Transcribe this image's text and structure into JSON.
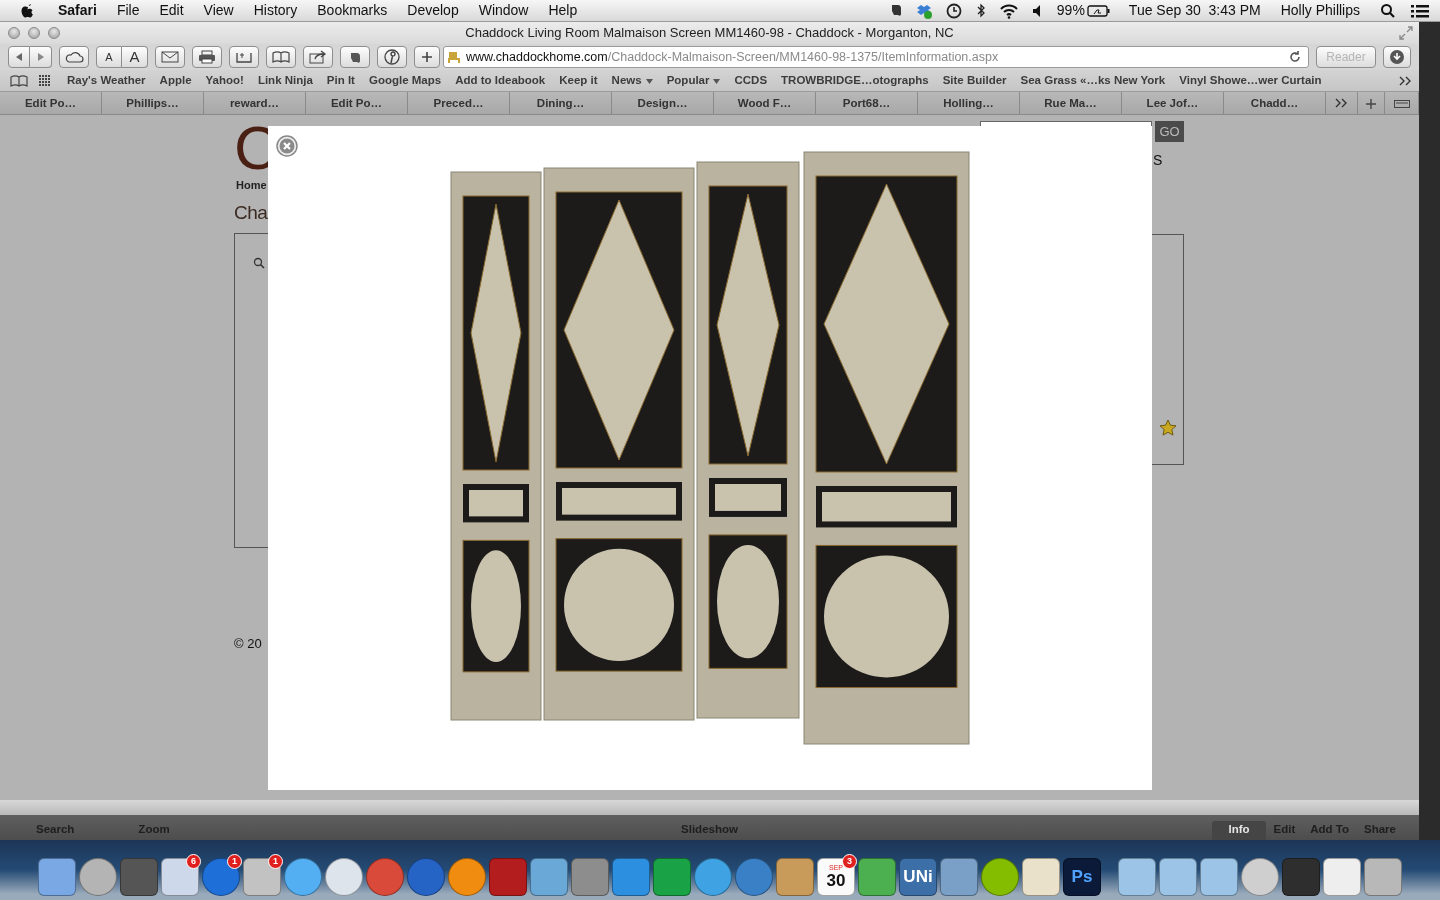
{
  "menu_bar": {
    "app": "Safari",
    "menus": [
      "File",
      "Edit",
      "View",
      "History",
      "Bookmarks",
      "Develop",
      "Window",
      "Help"
    ],
    "battery": "99%",
    "clock": "Tue Sep 30  3:43 PM",
    "user": "Holly Phillips"
  },
  "window": {
    "title": "Chaddock Living Room Malmaison Screen MM1460-98 - Chaddock - Morganton, NC"
  },
  "toolbar": {
    "text_smaller": "A",
    "text_larger": "A",
    "address_host": "www.chaddockhome.com",
    "address_path": "/Chaddock-Malmaison-Screen/MM1460-98-1375/ItemInformation.aspx",
    "reader": "Reader",
    "reader_disabled": true
  },
  "bookmarks": [
    {
      "label": "Ray's Weather",
      "menu": false
    },
    {
      "label": "Apple",
      "menu": false
    },
    {
      "label": "Yahoo!",
      "menu": false
    },
    {
      "label": "Link Ninja",
      "menu": false
    },
    {
      "label": "Pin It",
      "menu": false
    },
    {
      "label": "Google Maps",
      "menu": false
    },
    {
      "label": "Add to Ideabook",
      "menu": false
    },
    {
      "label": "Keep it",
      "menu": false
    },
    {
      "label": "News",
      "menu": true
    },
    {
      "label": "Popular",
      "menu": true
    },
    {
      "label": "CCDS",
      "menu": false
    },
    {
      "label": "TROWBRIDGE…otographs",
      "menu": false
    },
    {
      "label": "Site Builder",
      "menu": false
    },
    {
      "label": "Sea Grass «…ks New York",
      "menu": false
    },
    {
      "label": "Vinyl Showe…wer Curtain",
      "menu": false
    }
  ],
  "tabs": [
    "Edit Po…",
    "Phillips…",
    "reward…",
    "Edit Po…",
    "Preced…",
    "Dining…",
    "Design…",
    "Wood F…",
    "Port68…",
    "Holling…",
    "Rue Ma…",
    "Lee Jof…",
    "Chadd…"
  ],
  "page": {
    "logo": "C",
    "breadcrumb": "Home",
    "heading": "Cha",
    "search_button": "GO",
    "side_letter": "S",
    "copyright": "© 20"
  },
  "behind_window": {
    "toolbar": [
      {
        "label": "Search",
        "selected": false
      },
      {
        "label": "Zoom",
        "selected": false
      },
      {
        "label": "Slideshow",
        "selected": false
      },
      {
        "label": "Info",
        "selected": true
      },
      {
        "label": "Edit",
        "selected": false
      },
      {
        "label": "Add To",
        "selected": false
      },
      {
        "label": "Share",
        "selected": false
      }
    ]
  },
  "dock": [
    {
      "badge": "6"
    },
    {
      "badge": "1"
    },
    {
      "badge": "1"
    },
    {
      "badge": "3",
      "month": "SEP",
      "date": "30"
    },
    {
      "label": "UNi"
    },
    {
      "label": "Ps"
    }
  ]
}
